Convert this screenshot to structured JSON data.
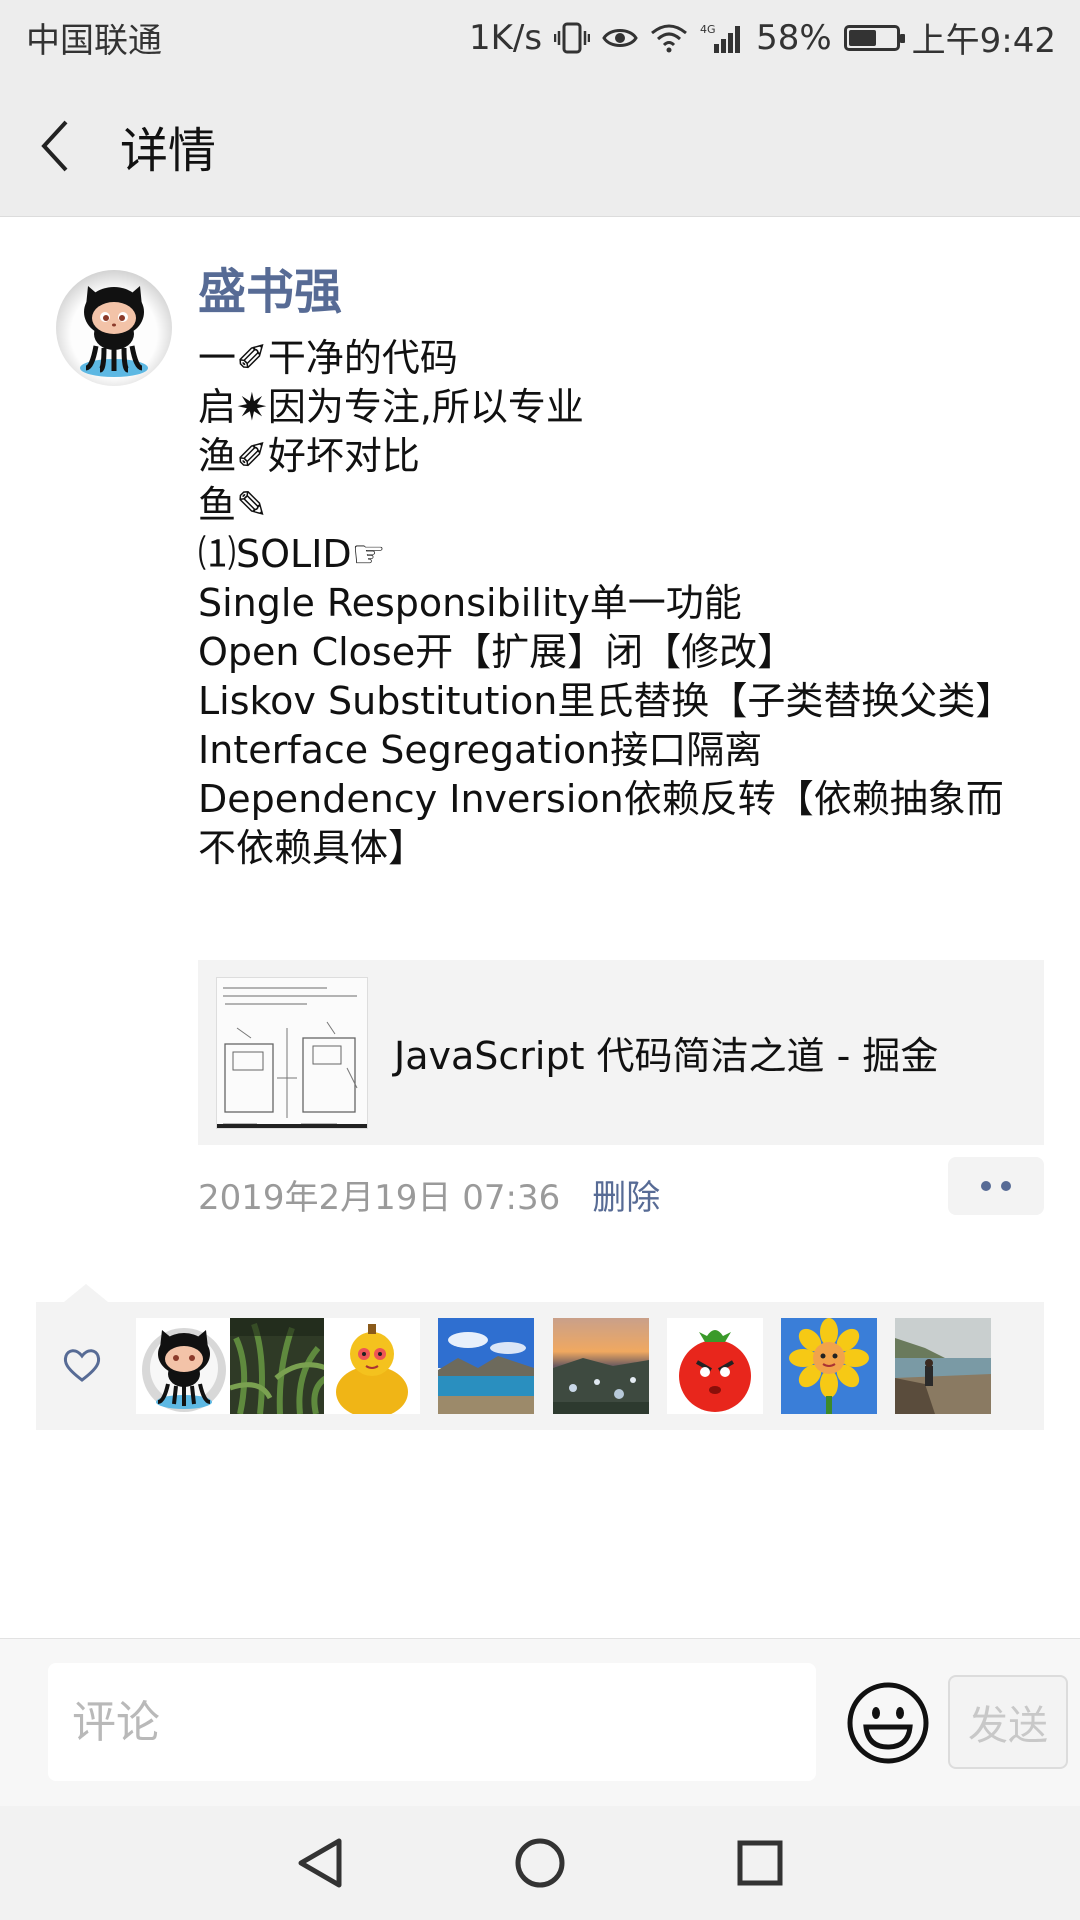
{
  "status_bar": {
    "carrier": "中国联通",
    "speed": "1K/s",
    "network": "4G",
    "battery": "58%",
    "battery_level": 0.58,
    "time": "上午9:42"
  },
  "nav": {
    "title": "详情",
    "back_icon": "chevron-left-icon"
  },
  "post": {
    "author": "盛书强",
    "lines": [
      "一✐干净的代码",
      "启✷因为专注,所以专业",
      "渔✐好坏对比",
      "鱼✎",
      "⑴SOLID☞",
      "Single Responsibility单一功能",
      "Open Close开【扩展】闭【修改】",
      "Liskov Substitution里氏替换【子类替换父类】",
      "Interface Segregation接口隔离",
      "Dependency Inversion依赖反转【依赖抽象而不依赖具体】"
    ],
    "link": {
      "title": "JavaScript 代码简洁之道 - 掘金"
    },
    "timestamp": "2019年2月19日 07:36",
    "delete_label": "删除"
  },
  "likes": {
    "icon": "heart-outline-icon",
    "avatars": [
      "github-octocat",
      "green-plants",
      "yellow-gourd",
      "lake-landscape",
      "sunset-village",
      "angry-tomato",
      "sunflower",
      "seaside-person"
    ]
  },
  "comment": {
    "placeholder": "评论",
    "send_label": "发送",
    "emoji_icon": "smiley-icon"
  },
  "system_nav": [
    "back-triangle-icon",
    "home-circle-icon",
    "recents-square-icon"
  ],
  "colors": {
    "link_blue": "#576b95",
    "bar_gray": "#ededed",
    "card_gray": "#f3f3f3"
  }
}
